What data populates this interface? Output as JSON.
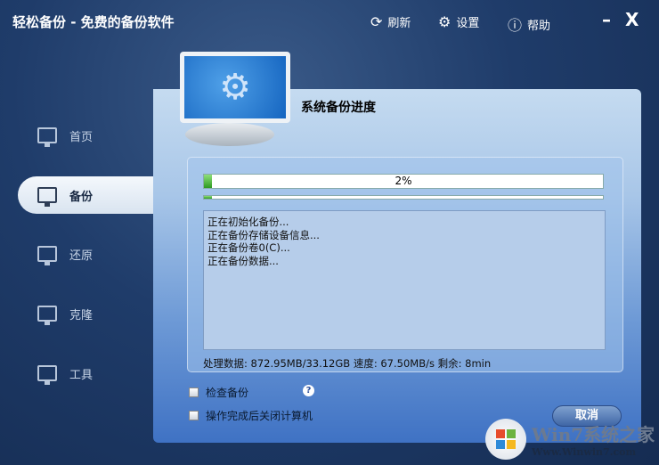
{
  "app": {
    "title": "轻松备份 - 免费的备份软件"
  },
  "toolbar": {
    "refresh": "刷新",
    "settings": "设置",
    "help": "帮助",
    "minimize": "–",
    "close": "X"
  },
  "sidebar": {
    "items": [
      {
        "label": "首页"
      },
      {
        "label": "备份",
        "selected": true
      },
      {
        "label": "还原"
      },
      {
        "label": "克隆"
      },
      {
        "label": "工具"
      }
    ]
  },
  "main": {
    "title": "系统备份进度",
    "progress": {
      "percent": 2,
      "label": "2%"
    },
    "log": [
      "正在初始化备份...",
      "正在备份存储设备信息...",
      "正在备份卷0(C)...",
      "正在备份数据..."
    ],
    "stats": "处理数据: 872.95MB/33.12GB  速度: 67.50MB/s  剩余: 8min",
    "options": [
      {
        "label": "检查备份",
        "checked": false
      },
      {
        "label": "操作完成后关闭计算机",
        "checked": false
      }
    ],
    "help_icon": "?",
    "cancel": "取消"
  },
  "watermark": {
    "brand": "Win7系统之家",
    "url": "Www.Winwin7.com"
  }
}
